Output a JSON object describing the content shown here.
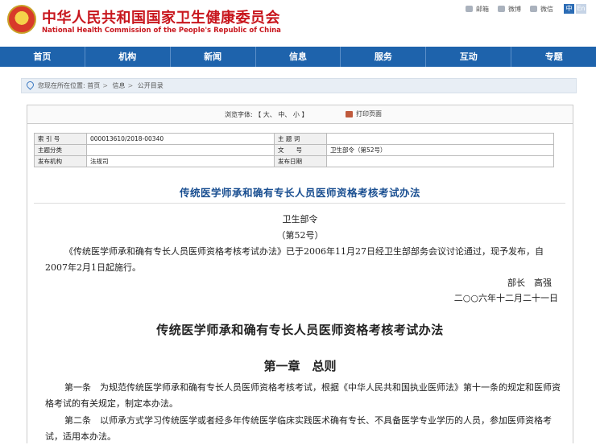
{
  "header": {
    "site_name_cn": "中华人民共和国国家卫生健康委员会",
    "site_name_en": "National Health Commission of the People's Republic of China",
    "tools": [
      {
        "icon": "mail-icon",
        "label": "邮箱"
      },
      {
        "icon": "weibo-icon",
        "label": "微博"
      },
      {
        "icon": "wechat-icon",
        "label": "微信"
      }
    ],
    "lang_cn": "中",
    "lang_en": "En"
  },
  "nav": [
    "首页",
    "机构",
    "新闻",
    "信息",
    "服务",
    "互动",
    "专题"
  ],
  "breadcrumb": {
    "label": "您现在所在位置:",
    "items": [
      "首页",
      "信息",
      "公开目录"
    ]
  },
  "fontbar": {
    "label": "浏览字体:",
    "open_bracket": "【",
    "large": "大",
    "medium": "中",
    "small": "小",
    "close_bracket": "】",
    "print_label": "打印页面"
  },
  "meta": {
    "index_label": "索 引 号",
    "index_value": "000013610/2018-00340",
    "subject_word_label": "主 题 词",
    "subject_word_value": "",
    "category_label": "主题分类",
    "category_value": "",
    "docno_label": "文　　号",
    "docno_value": "卫生部令（第52号）",
    "org_label": "发布机构",
    "org_value": "法规司",
    "date_label": "发布日期",
    "date_value": ""
  },
  "doc_title": "传统医学师承和确有专长人员医师资格考核考试办法",
  "document": {
    "order_name": "卫生部令",
    "order_no": "（第52号）",
    "intro": "《传统医学师承和确有专长人员医师资格考核考试办法》已于2006年11月27日经卫生部部务会议讨论通过，现予发布，自2007年2月1日起施行。",
    "signer": "部长　高强",
    "date": "二○○六年十二月二十一日",
    "title": "传统医学师承和确有专长人员医师资格考核考试办法",
    "chapter": "第一章　总则",
    "article1": "第一条　为规范传统医学师承和确有专长人员医师资格考核考试，根据《中华人民共和国执业医师法》第十一条的规定和医师资格考试的有关规定，制定本办法。",
    "article2": "第二条　以师承方式学习传统医学或者经多年传统医学临床实践医术确有专长、不具备医学专业学历的人员，参加医师资格考试，适用本办法。"
  }
}
